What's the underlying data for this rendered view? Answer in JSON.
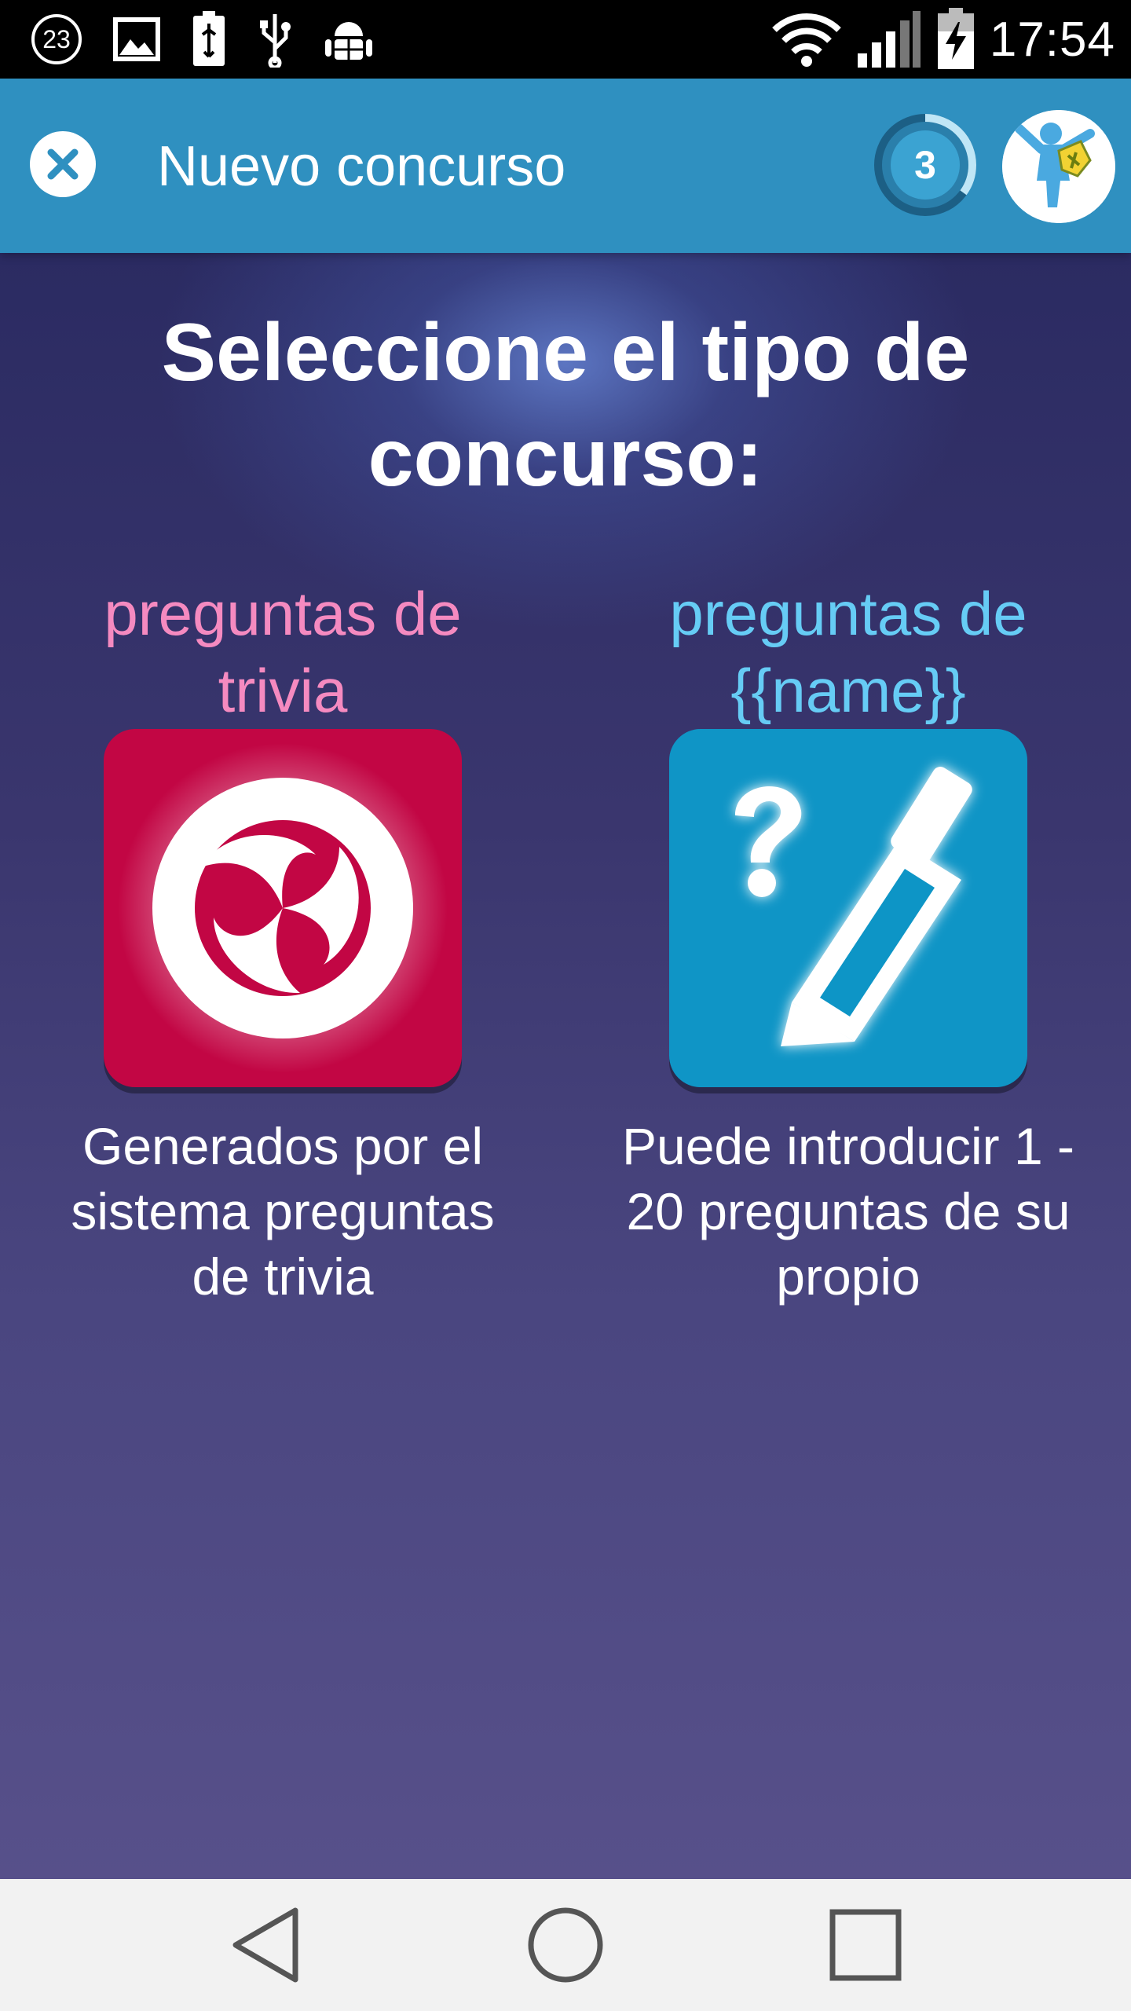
{
  "status_bar": {
    "notification_badge": "23",
    "time": "17:54",
    "icons": [
      "image-icon",
      "usb-battery-icon",
      "usb-icon",
      "android-debug-icon",
      "wifi-icon",
      "signal-icon",
      "battery-charging-icon"
    ]
  },
  "app_bar": {
    "title": "Nuevo concurso",
    "level": "3",
    "level_progress": 0.35,
    "color": "#2f90c0"
  },
  "main": {
    "headline_line1": "Seleccione el tipo de",
    "headline_line2": "concurso:",
    "options": [
      {
        "label_line1": "preguntas de",
        "label_line2": "trivia",
        "label_color": "#f58ac0",
        "tile_color": "#c20644",
        "icon": "trivia-swirl-icon",
        "desc_line1": "Generados por el",
        "desc_line2": "sistema preguntas",
        "desc_line3": "de trivia"
      },
      {
        "label_line1": "preguntas de",
        "label_line2": "{{name}}",
        "label_color": "#66ccf5",
        "tile_color": "#0f95c6",
        "icon": "question-pencil-icon",
        "desc_line1": "Puede introducir 1 -",
        "desc_line2": "20 preguntas de su",
        "desc_line3": "propio"
      }
    ]
  },
  "nav_bar": {
    "icons": [
      "back-triangle-icon",
      "home-circle-icon",
      "recents-square-icon"
    ]
  }
}
